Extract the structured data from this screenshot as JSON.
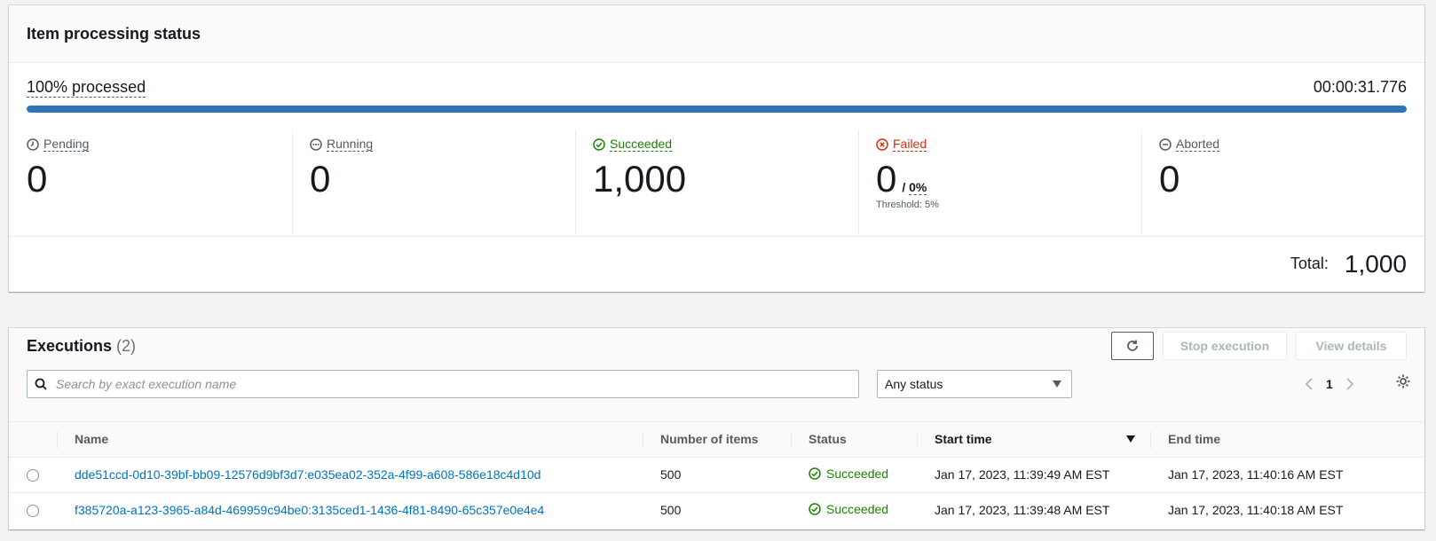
{
  "status_panel": {
    "title": "Item processing status",
    "progress_label": "100% processed",
    "progress_fraction": 1.0,
    "elapsed": "00:00:31.776",
    "stats": {
      "pending": {
        "label": "Pending",
        "value": "0"
      },
      "running": {
        "label": "Running",
        "value": "0"
      },
      "succeeded": {
        "label": "Succeeded",
        "value": "1,000"
      },
      "failed": {
        "label": "Failed",
        "value": "0",
        "percent": "0%",
        "separator": "/",
        "threshold": "Threshold: 5%"
      },
      "aborted": {
        "label": "Aborted",
        "value": "0"
      }
    },
    "total_label": "Total:",
    "total_value": "1,000"
  },
  "executions": {
    "title": "Executions",
    "count": "(2)",
    "stop_label": "Stop execution",
    "view_label": "View details",
    "search_placeholder": "Search by exact execution name",
    "status_filter": "Any status",
    "page": "1",
    "columns": {
      "name": "Name",
      "items": "Number of items",
      "status": "Status",
      "start": "Start time",
      "end": "End time"
    },
    "rows": [
      {
        "name": "dde51ccd-0d10-39bf-bb09-12576d9bf3d7:e035ea02-352a-4f99-a608-586e18c4d10d",
        "items": "500",
        "status": "Succeeded",
        "start": "Jan 17, 2023, 11:39:49 AM EST",
        "end": "Jan 17, 2023, 11:40:16 AM EST"
      },
      {
        "name": "f385720a-a123-3965-a84d-469959c94be0:3135ced1-1436-4f81-8490-65c357e0e4e4",
        "items": "500",
        "status": "Succeeded",
        "start": "Jan 17, 2023, 11:39:48 AM EST",
        "end": "Jan 17, 2023, 11:40:18 AM EST"
      }
    ]
  },
  "colors": {
    "accent": "#2d74b8",
    "success": "#1d8102",
    "error": "#d13212",
    "link": "#0073bb"
  }
}
